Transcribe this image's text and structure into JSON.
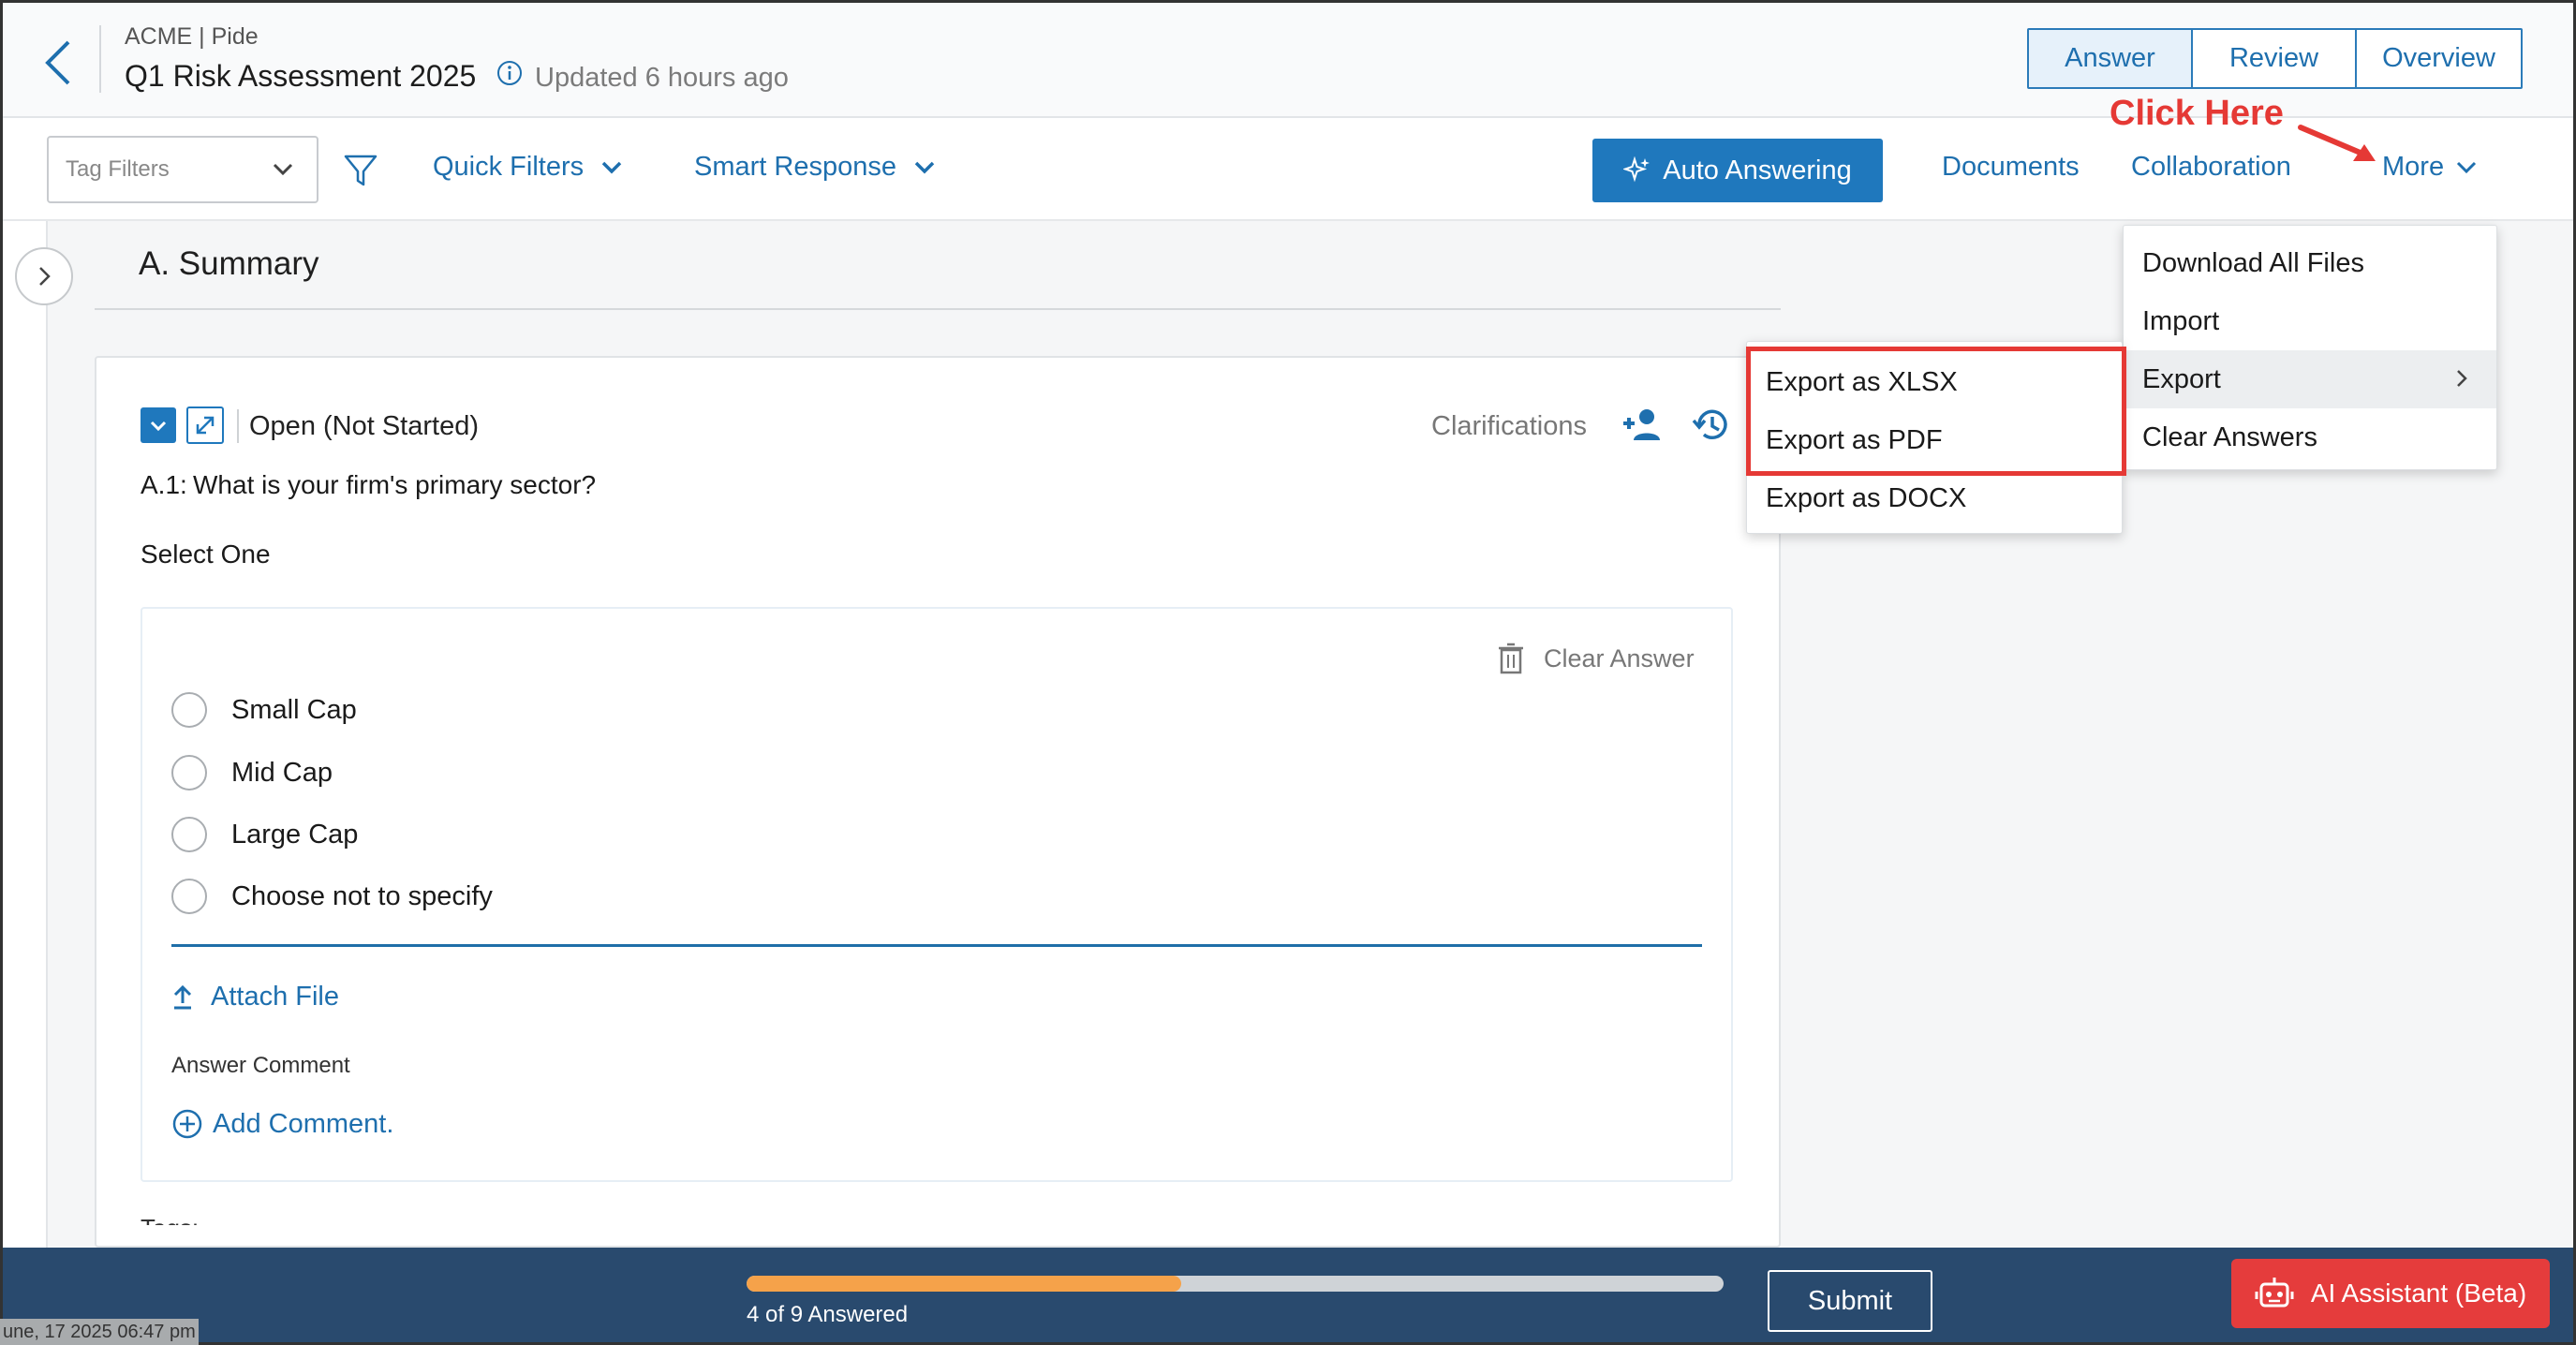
{
  "header": {
    "org_label": "ACME | Pide",
    "title": "Q1 Risk Assessment 2025",
    "updated_text": "Updated 6 hours ago",
    "view_tabs": [
      {
        "label": "Answer",
        "active": true
      },
      {
        "label": "Review",
        "active": false
      },
      {
        "label": "Overview",
        "active": false
      }
    ]
  },
  "toolbar": {
    "tag_filter_placeholder": "Tag Filters",
    "quick_filters_label": "Quick Filters",
    "smart_response_label": "Smart Response",
    "auto_answering_label": "Auto Answering",
    "documents_label": "Documents",
    "collaboration_label": "Collaboration",
    "more_label": "More"
  },
  "annotation": {
    "click_here": "Click Here",
    "color": "#e53935"
  },
  "section": {
    "title": "A. Summary"
  },
  "question": {
    "status": "Open (Not Started)",
    "clarifications_label": "Clarifications",
    "number": "A.1:",
    "text": "What is your firm's primary sector?",
    "instruction": "Select One",
    "clear_answer_label": "Clear Answer",
    "options": [
      "Small Cap",
      "Mid Cap",
      "Large Cap",
      "Choose not to specify"
    ],
    "attach_label": "Attach File",
    "answer_comment_label": "Answer Comment",
    "add_comment_label": "Add Comment.",
    "tags_label": "Tags:"
  },
  "more_menu": {
    "items": [
      "Download All Files",
      "Import",
      "Export",
      "Clear Answers"
    ],
    "hovered": "Export"
  },
  "export_submenu": {
    "items": [
      "Export as XLSX",
      "Export as PDF",
      "Export as DOCX"
    ]
  },
  "footer": {
    "answered": 4,
    "total": 9,
    "progress_label": "4 of 9 Answered",
    "submit_label": "Submit",
    "ai_assistant_label": "AI Assistant (Beta)",
    "timestamp": "une, 17 2025 06:47 pm"
  },
  "colors": {
    "primary": "#1f78bd",
    "footer_bg": "#294a6e",
    "progress_fill": "#f5a24a",
    "ai_button": "#e53c3c"
  }
}
